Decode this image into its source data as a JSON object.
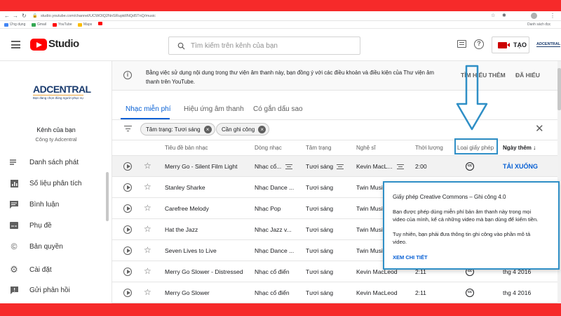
{
  "browser": {
    "url": "studio.youtube.com/channel/UCWOlQ2NnSRuptdINQd5TnQ/music",
    "bookmarks": [
      {
        "label": "Ứng dụng",
        "icon": "apps-grid-icon",
        "color": "#4285f4"
      },
      {
        "label": "Gmail",
        "icon": "google-g-icon",
        "color": "#34a853"
      },
      {
        "label": "YouTube",
        "icon": "youtube-icon",
        "color": "#ff0000"
      },
      {
        "label": "Maps",
        "icon": "maps-pin-icon",
        "color": "#fbbc04"
      },
      {
        "label": "",
        "icon": "youtube-icon",
        "color": "#ff0000"
      }
    ],
    "reading_list": "Danh sách đọc"
  },
  "header": {
    "logo_text": "Studio",
    "search_placeholder": "Tìm kiếm trên kênh của bạn",
    "create_label": "TẠO",
    "account_logo": "ADCENTRAL"
  },
  "sidebar": {
    "brand_name": "ADCENTRAL",
    "brand_tagline": "Bạn đang chọn đúng người phục vụ",
    "channel_title": "Kênh của bạn",
    "channel_name": "Công ty Adcentral",
    "items": [
      {
        "label": "Danh sách phát",
        "icon": "playlist-icon"
      },
      {
        "label": "Số liệu phân tích",
        "icon": "analytics-icon"
      },
      {
        "label": "Bình luận",
        "icon": "comments-icon"
      },
      {
        "label": "Phụ đề",
        "icon": "subtitles-icon"
      },
      {
        "label": "Bản quyền",
        "icon": "copyright-icon"
      },
      {
        "label": "Cài đặt",
        "icon": "gear-icon"
      },
      {
        "label": "Gửi phản hồi",
        "icon": "feedback-icon"
      }
    ]
  },
  "notice": {
    "text_line1": "Bằng việc sử dụng nội dung trong thư viện âm thanh này, bạn đồng ý với các điều khoản và điều kiện của Thư viện âm",
    "text_line2": "thanh trên YouTube.",
    "learn_more": "TÌM HIỂU THÊM",
    "dismiss": "ĐÃ HIỂU"
  },
  "tabs": [
    {
      "label": "Nhạc miễn phí",
      "active": true
    },
    {
      "label": "Hiệu ứng âm thanh",
      "active": false
    },
    {
      "label": "Có gắn dấu sao",
      "active": false
    }
  ],
  "filters": {
    "chips": [
      "Tâm trạng: Tươi sáng",
      "Cần ghi công"
    ]
  },
  "table": {
    "columns": [
      "Tiêu đề bản nhạc",
      "Dòng nhạc",
      "Tâm trạng",
      "Nghệ sĩ",
      "Thời lượng",
      "Loại giấy phép",
      "Ngày thêm"
    ],
    "rows": [
      {
        "title": "Merry Go - Silent Film Light",
        "genre": "Nhạc cổ...",
        "mood": "Tươi sáng",
        "artist": "Kevin MacL...",
        "duration": "2:00",
        "license": "cc",
        "date": "TẢI XUỐNG"
      },
      {
        "title": "Stanley Sharke",
        "genre": "Nhạc Dance ...",
        "mood": "Tươi sáng",
        "artist": "Twin Music",
        "duration": "",
        "license": "",
        "date": ""
      },
      {
        "title": "Carefree Melody",
        "genre": "Nhạc Pop",
        "mood": "Tươi sáng",
        "artist": "Twin Music",
        "duration": "",
        "license": "",
        "date": ""
      },
      {
        "title": "Hat the Jazz",
        "genre": "Nhạc Jazz v...",
        "mood": "Tươi sáng",
        "artist": "Twin Music",
        "duration": "",
        "license": "",
        "date": ""
      },
      {
        "title": "Seven Lives to Live",
        "genre": "Nhạc Dance ...",
        "mood": "Tươi sáng",
        "artist": "Twin Music",
        "duration": "",
        "license": "",
        "date": ""
      },
      {
        "title": "Merry Go Slower - Distressed",
        "genre": "Nhạc cổ điển",
        "mood": "Tươi sáng",
        "artist": "Kevin MacLeod",
        "duration": "2:11",
        "license": "cc",
        "date": "thg 4 2016"
      },
      {
        "title": "Merry Go Slower",
        "genre": "Nhạc cổ điển",
        "mood": "Tươi sáng",
        "artist": "Kevin MacLeod",
        "duration": "2:11",
        "license": "cc",
        "date": "thg 4 2016"
      }
    ]
  },
  "popup": {
    "title": "Giấy phép Creative Commons – Ghi công 4.0",
    "body1_line1": "Bạn được phép dùng miễn phí bản âm thanh này trong mọi",
    "body1_line2": "video của mình, kể cả những video mà bạn dùng để kiếm tiền.",
    "body2_line1": "Tuy nhiên, bạn phải đưa thông tin ghi công vào phần mô tả",
    "body2_line2": "video.",
    "link": "XEM CHI TIẾT"
  },
  "colors": {
    "frame_red": "#f62a2a",
    "accent_blue": "#065fd4",
    "annotation_blue": "#2f8fc6",
    "youtube_red": "#ff0000"
  }
}
